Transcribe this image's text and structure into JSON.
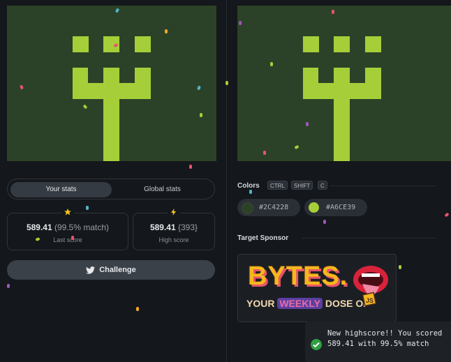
{
  "stats": {
    "tabs": [
      "Your stats",
      "Global stats"
    ],
    "active_tab": "Your stats",
    "last_score": {
      "value": "589.41",
      "detail": "(99.5% match)",
      "label": "Last score",
      "icon": "star-icon"
    },
    "high_score": {
      "value": "589.41",
      "detail": "{393}",
      "label": "High score",
      "icon": "lightning-icon"
    }
  },
  "challenge": {
    "label": "Challenge",
    "icon": "twitter-bird-icon"
  },
  "colors": {
    "title": "Colors",
    "shortcut": [
      "CTRL",
      "SHIFT",
      "C"
    ],
    "swatches": [
      {
        "hex": "#2C4228"
      },
      {
        "hex": "#A6CE39"
      }
    ]
  },
  "sponsor": {
    "title": "Target Sponsor",
    "logo_word": "BYTES.",
    "tagline_prefix": "YOUR",
    "tagline_highlight": "WEEKLY",
    "tagline_suffix": "DOSE OF",
    "badge": "JS"
  },
  "toast": {
    "message": "New highscore!! You scored 589.41 with 99.5% match",
    "icon": "check-circle-icon"
  }
}
